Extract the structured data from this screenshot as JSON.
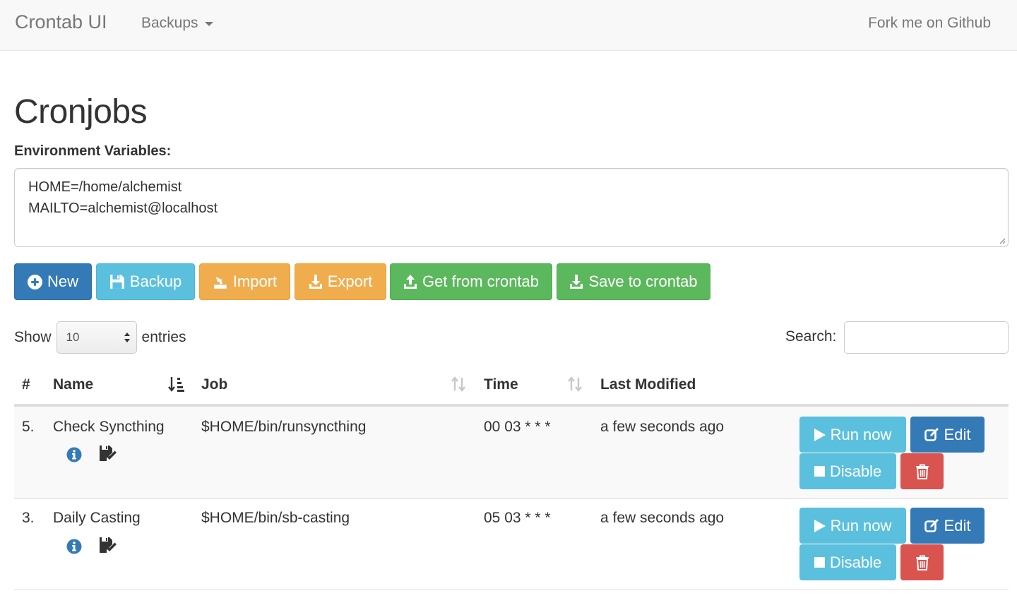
{
  "navbar": {
    "brand": "Crontab UI",
    "menu_backups": "Backups",
    "fork_link": "Fork me on Github"
  },
  "page": {
    "title": "Cronjobs",
    "env_label": "Environment Variables:",
    "env_lines": [
      "HOME=/home/alchemist",
      "MAILTO=alchemist@localhost"
    ]
  },
  "actions": {
    "new": "New",
    "backup": "Backup",
    "import": "Import",
    "export": "Export",
    "get_from_crontab": "Get from crontab",
    "save_to_crontab": "Save to crontab"
  },
  "table_controls": {
    "show": "Show",
    "entries_value": "10",
    "entries": "entries",
    "search": "Search:"
  },
  "table": {
    "headers": [
      "#",
      "Name",
      "Job",
      "Time",
      "Last Modified"
    ],
    "rows": [
      {
        "num": "5.",
        "name": "Check Syncthing",
        "job": "$HOME/bin/runsyncthing",
        "time": "00 03 * * *",
        "modified": "a few seconds ago"
      },
      {
        "num": "3.",
        "name": "Daily Casting",
        "job": "$HOME/bin/sb-casting",
        "time": "05 03 * * *",
        "modified": "a few seconds ago"
      }
    ],
    "row_buttons": {
      "run_now": "Run now",
      "edit": "Edit",
      "disable": "Disable"
    }
  },
  "colors": {
    "primary": "#337ab7",
    "info": "#5bc0de",
    "warning": "#f0ad4e",
    "success": "#5cb85c",
    "danger": "#d9534f"
  }
}
